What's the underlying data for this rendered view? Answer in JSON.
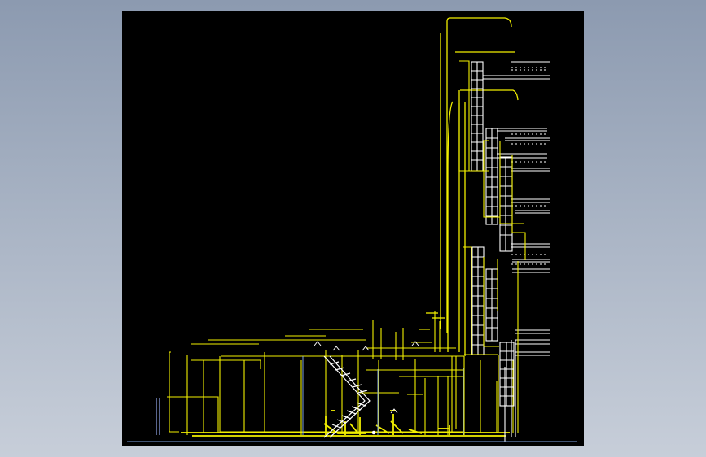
{
  "viewer": {
    "canvas_label": "",
    "drawing_icon": "cad-drawing-icon",
    "colors": {
      "background": "#8f9cb1",
      "canvas": "#000000",
      "primary_line": "#f2ef00",
      "secondary_line": "#ffffff",
      "accent_line": "#89a7d8"
    }
  }
}
